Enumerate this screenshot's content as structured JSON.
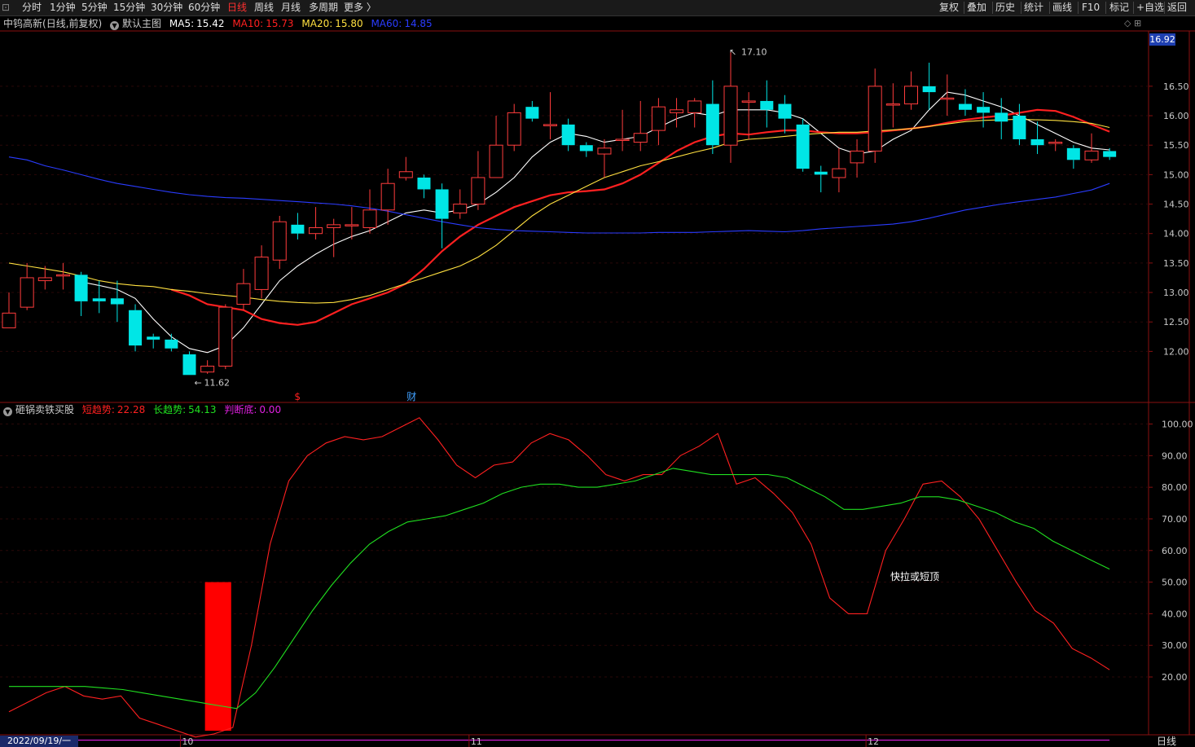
{
  "toolbar": {
    "periods": [
      "分时",
      "1分钟",
      "5分钟",
      "15分钟",
      "30分钟",
      "60分钟",
      "日线",
      "周线",
      "月线",
      "多周期",
      "更多 〉"
    ],
    "active_period": "日线",
    "right_buttons": [
      "复权",
      "叠加",
      "历史",
      "统计",
      "画线",
      "F10",
      "标记",
      "+自选",
      "返回"
    ]
  },
  "main_panel": {
    "stock": "中钨高新",
    "mode": "(日线,前复权)",
    "template_label": "默认主图",
    "ma": [
      {
        "label": "MA5:",
        "value": "15.42",
        "color": "#ffffff"
      },
      {
        "label": "MA10:",
        "value": "15.73",
        "color": "#ff2020"
      },
      {
        "label": "MA20:",
        "value": "15.80",
        "color": "#ffe040"
      },
      {
        "label": "MA60:",
        "value": "14.85",
        "color": "#2a3cff"
      }
    ],
    "last_price_box": "16.92",
    "high_label": "17.10",
    "low_label": "11.62",
    "event_marks": [
      {
        "text": "$",
        "color": "#ff2020"
      },
      {
        "text": "财",
        "color": "#40a0ff"
      }
    ],
    "panel_buttons": "◇ ⊞"
  },
  "indicator_panel": {
    "name": "砸锅卖铁买股",
    "values": [
      {
        "label": "短趋势:",
        "value": "22.28",
        "color": "#ff2020"
      },
      {
        "label": "长趋势:",
        "value": "54.13",
        "color": "#20e020"
      },
      {
        "label": "判断底:",
        "value": "0.00",
        "color": "#e020e0"
      }
    ],
    "annotation": "快拉或短顶"
  },
  "bottom_bar": {
    "date": "2022/09/19/一",
    "period_label": "日线"
  },
  "chart_data": [
    {
      "type": "candlestick",
      "title": "中钨高新 (日线,前复权)",
      "y_ticks": [
        "12.00",
        "12.50",
        "13.00",
        "13.50",
        "14.00",
        "14.50",
        "15.00",
        "15.50",
        "16.00",
        "16.50"
      ],
      "ylim": [
        11.3,
        17.3
      ],
      "x_labels": [
        {
          "i": 10,
          "text": "10"
        },
        {
          "i": 26,
          "text": "11"
        },
        {
          "i": 48,
          "text": "12"
        }
      ],
      "colors": {
        "up": "#ff3c3c",
        "down": "#00e6e6"
      },
      "candles": [
        [
          12.4,
          12.65,
          13.0,
          12.4
        ],
        [
          12.75,
          13.25,
          13.5,
          12.7
        ],
        [
          13.2,
          13.25,
          13.45,
          13.05
        ],
        [
          13.3,
          13.3,
          13.5,
          13.05
        ],
        [
          13.3,
          12.85,
          13.35,
          12.6
        ],
        [
          12.9,
          12.85,
          13.2,
          12.65
        ],
        [
          12.9,
          12.8,
          13.2,
          12.5
        ],
        [
          12.7,
          12.1,
          12.8,
          12.0
        ],
        [
          12.25,
          12.2,
          12.3,
          12.05
        ],
        [
          12.2,
          12.05,
          12.3,
          12.0
        ],
        [
          11.95,
          11.6,
          12.0,
          11.6
        ],
        [
          11.65,
          11.75,
          11.85,
          11.62
        ],
        [
          11.75,
          12.75,
          12.8,
          11.7
        ],
        [
          12.8,
          13.15,
          13.4,
          12.7
        ],
        [
          13.05,
          13.6,
          13.8,
          12.9
        ],
        [
          13.55,
          14.2,
          14.3,
          13.4
        ],
        [
          14.15,
          14.0,
          14.35,
          13.9
        ],
        [
          14.0,
          14.1,
          14.45,
          13.9
        ],
        [
          14.1,
          14.15,
          14.25,
          13.6
        ],
        [
          14.15,
          14.15,
          14.45,
          13.9
        ],
        [
          14.1,
          14.4,
          14.75,
          14.0
        ],
        [
          14.4,
          14.85,
          15.1,
          14.15
        ],
        [
          14.95,
          15.05,
          15.3,
          14.9
        ],
        [
          14.95,
          14.75,
          15.0,
          14.6
        ],
        [
          14.75,
          14.25,
          14.85,
          13.75
        ],
        [
          14.35,
          14.5,
          14.75,
          14.25
        ],
        [
          14.5,
          14.95,
          15.4,
          14.4
        ],
        [
          14.95,
          15.5,
          16.0,
          14.95
        ],
        [
          15.5,
          16.05,
          16.2,
          15.4
        ],
        [
          16.15,
          15.95,
          16.25,
          15.9
        ],
        [
          15.85,
          15.85,
          16.4,
          15.6
        ],
        [
          15.85,
          15.5,
          15.95,
          15.4
        ],
        [
          15.5,
          15.4,
          15.55,
          15.3
        ],
        [
          15.35,
          15.45,
          15.6,
          14.95
        ],
        [
          15.6,
          15.6,
          16.1,
          15.4
        ],
        [
          15.55,
          15.7,
          16.25,
          15.4
        ],
        [
          15.75,
          16.15,
          16.3,
          15.5
        ],
        [
          16.05,
          16.1,
          16.3,
          15.8
        ],
        [
          16.05,
          16.25,
          16.3,
          15.8
        ],
        [
          16.2,
          15.5,
          16.6,
          15.35
        ],
        [
          15.5,
          16.5,
          17.1,
          15.2
        ],
        [
          16.25,
          16.25,
          16.4,
          15.6
        ],
        [
          16.25,
          16.1,
          16.6,
          15.8
        ],
        [
          16.2,
          15.95,
          16.35,
          15.7
        ],
        [
          15.85,
          15.1,
          15.95,
          15.05
        ],
        [
          15.05,
          15.0,
          15.15,
          14.7
        ],
        [
          14.95,
          15.1,
          15.45,
          14.7
        ],
        [
          15.2,
          15.4,
          15.6,
          14.95
        ],
        [
          15.4,
          16.5,
          16.8,
          15.2
        ],
        [
          16.2,
          16.2,
          16.55,
          15.8
        ],
        [
          16.2,
          16.5,
          16.75,
          16.1
        ],
        [
          16.5,
          16.4,
          16.9,
          16.1
        ],
        [
          16.3,
          16.3,
          16.7,
          16.0
        ],
        [
          16.2,
          16.1,
          16.45,
          16.0
        ],
        [
          16.15,
          16.05,
          16.4,
          15.8
        ],
        [
          16.05,
          15.9,
          16.3,
          15.6
        ],
        [
          16.0,
          15.6,
          16.2,
          15.5
        ],
        [
          15.6,
          15.5,
          15.9,
          15.35
        ],
        [
          15.55,
          15.55,
          15.6,
          15.4
        ],
        [
          15.45,
          15.25,
          15.5,
          15.1
        ],
        [
          15.25,
          15.4,
          15.7,
          15.2
        ],
        [
          15.4,
          15.3,
          15.45,
          15.25
        ]
      ],
      "series": [
        {
          "name": "MA5",
          "color": "#ffffff",
          "values": [
            null,
            null,
            null,
            null,
            13.18,
            13.12,
            13.05,
            12.9,
            12.55,
            12.25,
            12.05,
            11.98,
            12.1,
            12.4,
            12.8,
            13.2,
            13.45,
            13.65,
            13.82,
            13.95,
            14.05,
            14.2,
            14.35,
            14.4,
            14.35,
            14.4,
            14.5,
            14.7,
            14.95,
            15.3,
            15.55,
            15.7,
            15.65,
            15.55,
            15.6,
            15.65,
            15.8,
            15.95,
            16.05,
            16.0,
            16.1,
            16.1,
            16.1,
            16.05,
            15.95,
            15.7,
            15.45,
            15.35,
            15.4,
            15.6,
            15.75,
            16.1,
            16.4,
            16.35,
            16.25,
            16.15,
            16.0,
            15.85,
            15.7,
            15.55,
            15.45,
            15.42
          ]
        },
        {
          "name": "MA10",
          "color": "#ff2020",
          "values": [
            null,
            null,
            null,
            null,
            null,
            null,
            null,
            null,
            null,
            13.05,
            12.95,
            12.8,
            12.75,
            12.7,
            12.55,
            12.48,
            12.45,
            12.5,
            12.65,
            12.8,
            12.9,
            13.0,
            13.15,
            13.4,
            13.7,
            13.95,
            14.15,
            14.3,
            14.45,
            14.55,
            14.65,
            14.7,
            14.72,
            14.75,
            14.85,
            15.0,
            15.2,
            15.4,
            15.55,
            15.65,
            15.7,
            15.68,
            15.72,
            15.75,
            15.75,
            15.72,
            15.7,
            15.7,
            15.72,
            15.75,
            15.78,
            15.82,
            15.88,
            15.93,
            15.97,
            16.0,
            16.05,
            16.1,
            16.08,
            15.98,
            15.85,
            15.73
          ]
        },
        {
          "name": "MA20",
          "color": "#ffe040",
          "values": [
            13.5,
            13.45,
            13.4,
            13.35,
            13.28,
            13.2,
            13.15,
            13.12,
            13.1,
            13.05,
            13.02,
            12.98,
            12.95,
            12.92,
            12.88,
            12.85,
            12.83,
            12.82,
            12.83,
            12.88,
            12.95,
            13.05,
            13.15,
            13.25,
            13.35,
            13.45,
            13.6,
            13.8,
            14.05,
            14.3,
            14.5,
            14.65,
            14.8,
            14.95,
            15.05,
            15.15,
            15.22,
            15.3,
            15.38,
            15.45,
            15.55,
            15.6,
            15.62,
            15.65,
            15.68,
            15.7,
            15.72,
            15.72,
            15.74,
            15.76,
            15.78,
            15.82,
            15.86,
            15.9,
            15.92,
            15.93,
            15.94,
            15.93,
            15.92,
            15.9,
            15.87,
            15.8
          ]
        },
        {
          "name": "MA60",
          "color": "#2a3cff",
          "values": [
            15.3,
            15.25,
            15.15,
            15.08,
            15.0,
            14.92,
            14.85,
            14.8,
            14.75,
            14.7,
            14.66,
            14.63,
            14.61,
            14.6,
            14.58,
            14.56,
            14.54,
            14.52,
            14.5,
            14.47,
            14.43,
            14.38,
            14.32,
            14.26,
            14.2,
            14.15,
            14.1,
            14.07,
            14.05,
            14.04,
            14.03,
            14.02,
            14.01,
            14.01,
            14.01,
            14.01,
            14.02,
            14.02,
            14.02,
            14.03,
            14.04,
            14.05,
            14.04,
            14.03,
            14.05,
            14.08,
            14.1,
            14.12,
            14.14,
            14.16,
            14.2,
            14.26,
            14.33,
            14.4,
            14.45,
            14.5,
            14.54,
            14.58,
            14.62,
            14.68,
            14.74,
            14.85
          ]
        }
      ]
    },
    {
      "type": "line",
      "title": "砸锅卖铁买股",
      "y_ticks": [
        "20.00",
        "30.00",
        "40.00",
        "50.00",
        "60.00",
        "70.00",
        "80.00",
        "90.00",
        "100.00"
      ],
      "ylim": [
        3,
        104
      ],
      "series": [
        {
          "name": "短趋势",
          "color": "#ff2020",
          "values": [
            9,
            12,
            15,
            17,
            14,
            13,
            14,
            7,
            5,
            3,
            1,
            2,
            4,
            30,
            62,
            82,
            90,
            94,
            96,
            95,
            96,
            99,
            102,
            95,
            87,
            83,
            87,
            88,
            94,
            97,
            95,
            90,
            84,
            82,
            84,
            84,
            90,
            93,
            97,
            81,
            83,
            78,
            72,
            62,
            45,
            40,
            40,
            60,
            70,
            81,
            82,
            77,
            70,
            60,
            50,
            41,
            37,
            29,
            26,
            22.28
          ]
        },
        {
          "name": "长趋势",
          "color": "#20e020",
          "values": [
            17,
            17,
            17,
            17,
            17,
            16.5,
            16,
            15,
            14,
            13,
            12,
            11,
            10,
            15,
            23,
            32,
            41,
            49,
            56,
            62,
            66,
            69,
            70,
            71,
            73,
            75,
            78,
            80,
            81,
            81,
            80,
            80,
            81,
            82,
            84,
            86,
            85,
            84,
            84,
            84,
            84,
            83,
            80,
            77,
            73,
            73,
            74,
            75,
            77,
            77,
            76,
            74,
            72,
            69,
            67,
            63,
            60,
            57,
            54.13
          ]
        },
        {
          "name": "判断底",
          "color": "#e020e0",
          "values": [
            0,
            0,
            0,
            0,
            0,
            0,
            0,
            0,
            0,
            0,
            0,
            0,
            0,
            0,
            0,
            0,
            0,
            0,
            0,
            0,
            0,
            0,
            0,
            0,
            0,
            0,
            0,
            0,
            0,
            0,
            0,
            0,
            0,
            0,
            0,
            0,
            0,
            0,
            0,
            0,
            0,
            0,
            0,
            0,
            0,
            0,
            0,
            0,
            0,
            0,
            0,
            0,
            0,
            0,
            0,
            0,
            0,
            0,
            0,
            0,
            0.0
          ]
        }
      ],
      "bars": [
        {
          "x_from": 11,
          "x_to": 12,
          "value": 50,
          "color": "#ff0000"
        }
      ]
    }
  ]
}
